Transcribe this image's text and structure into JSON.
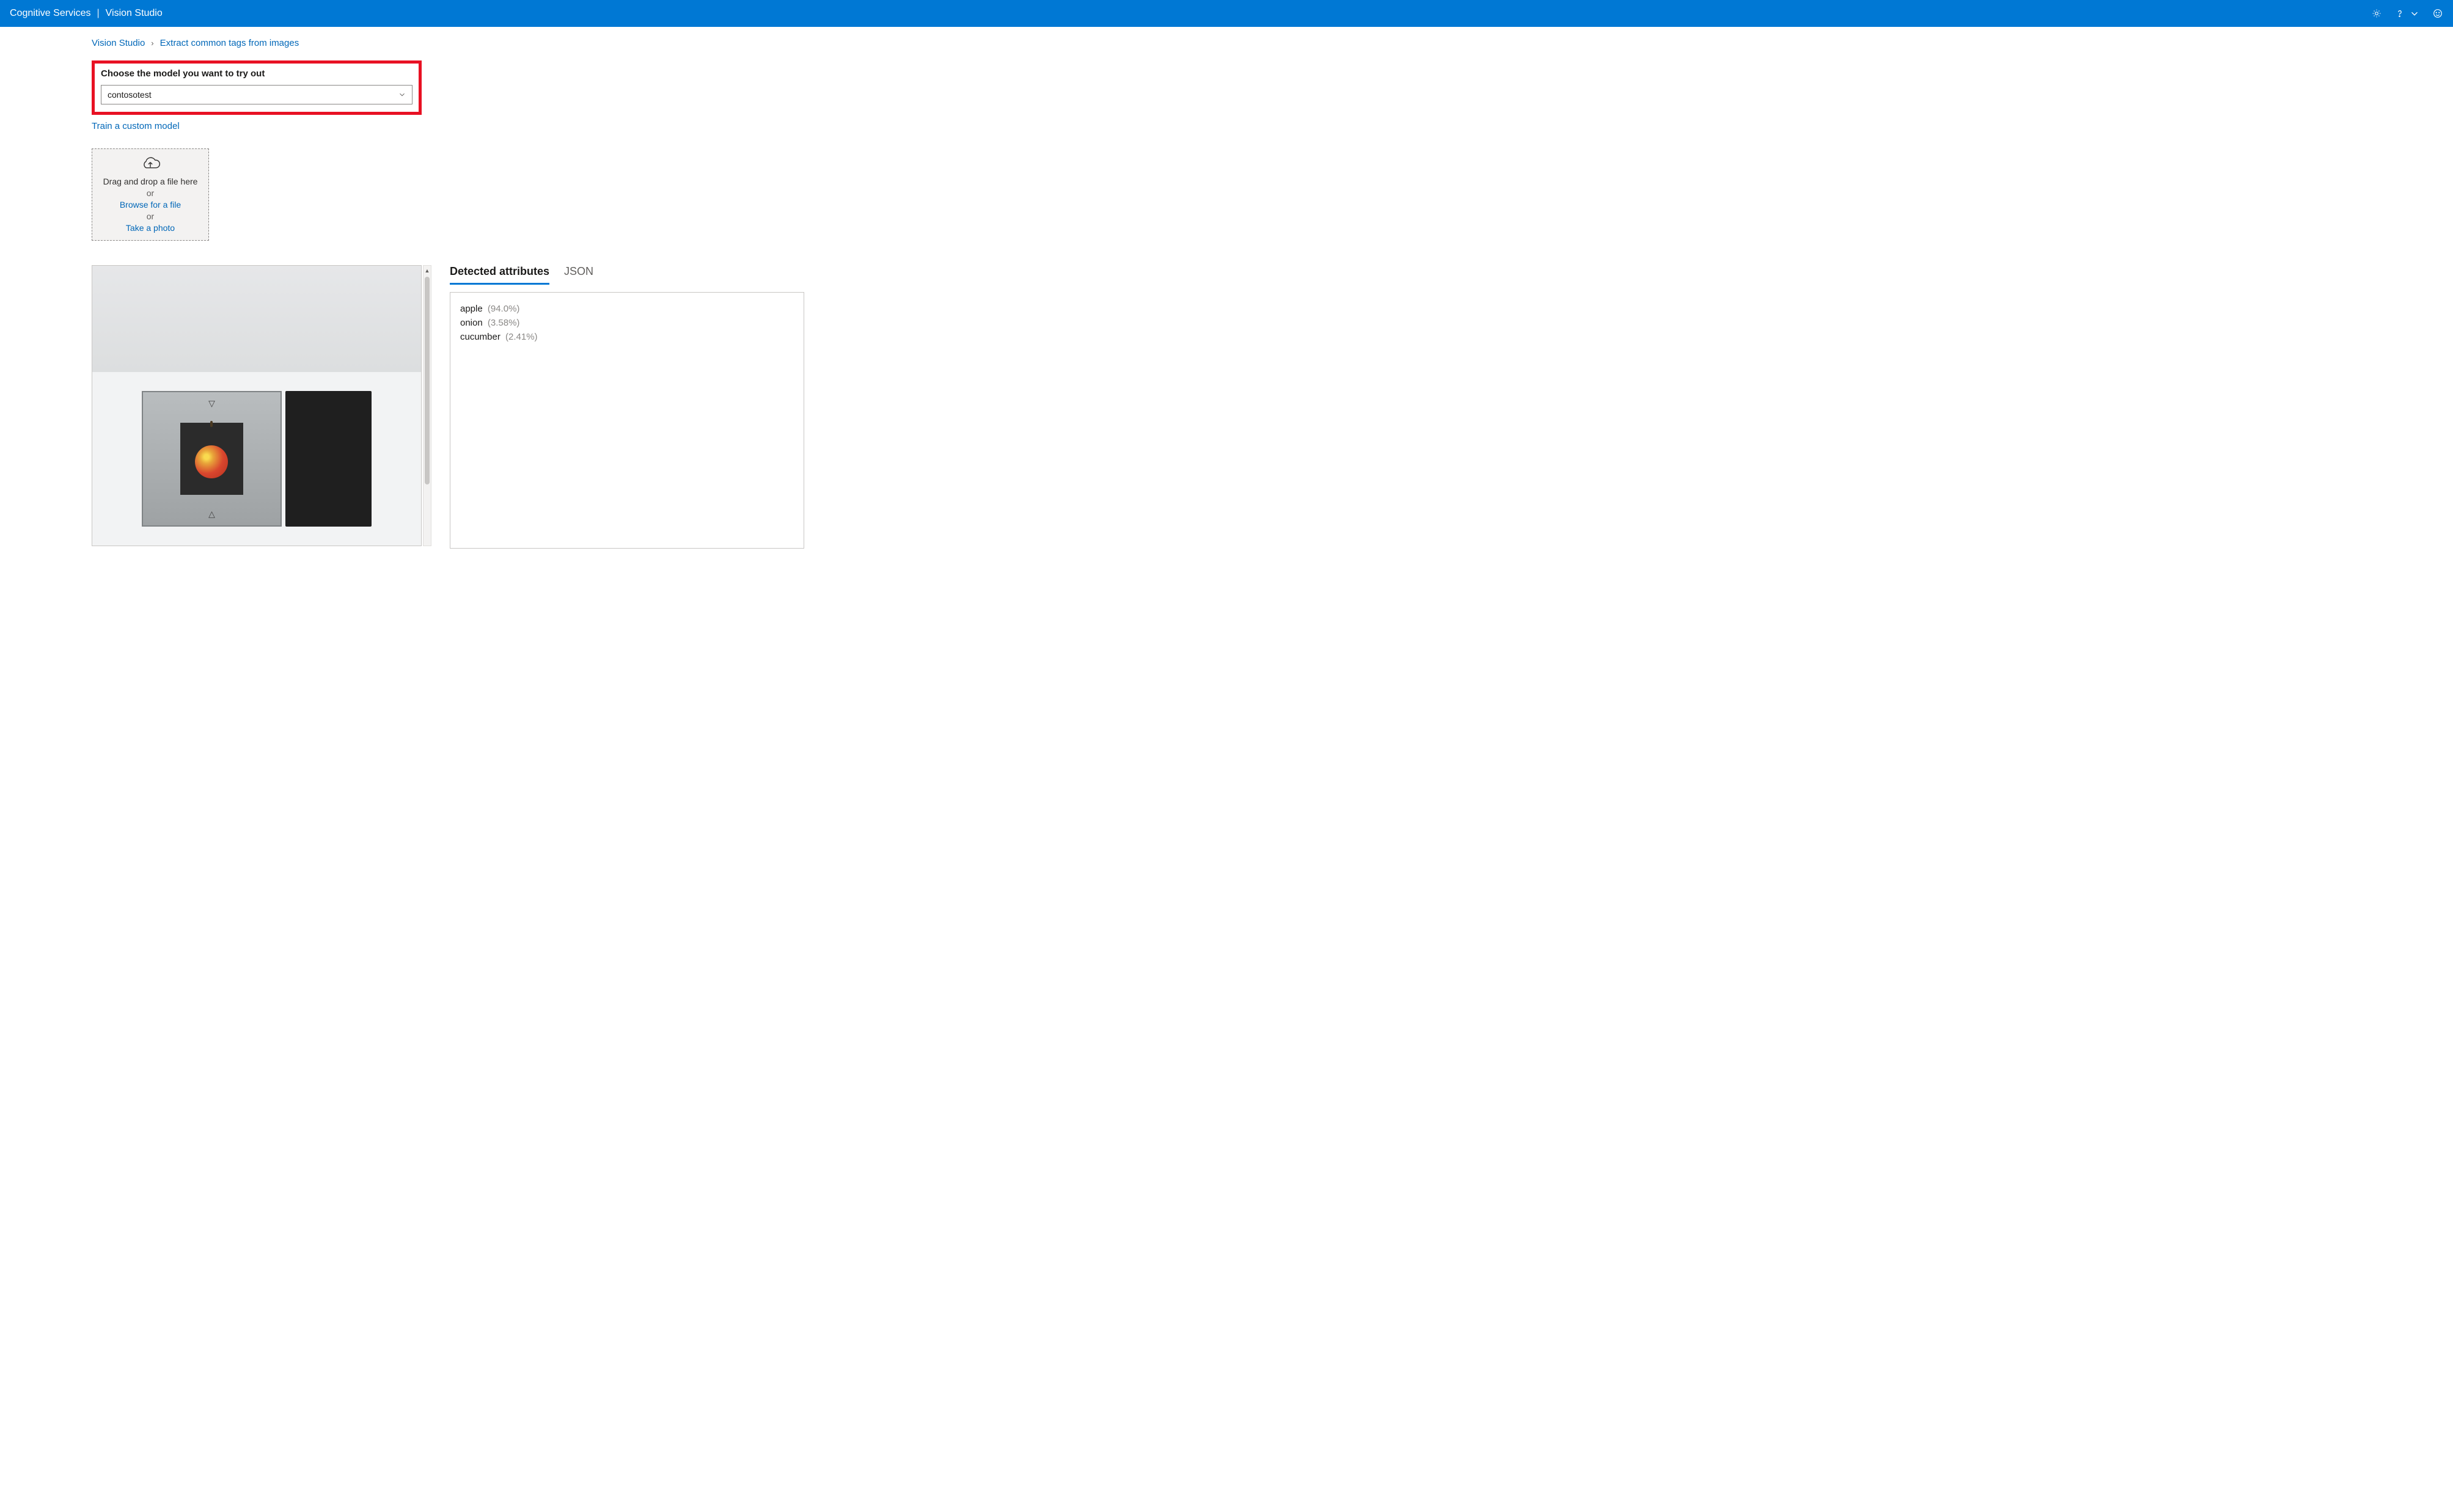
{
  "header": {
    "product": "Cognitive Services",
    "section": "Vision Studio"
  },
  "breadcrumb": {
    "root": "Vision Studio",
    "page": "Extract common tags from images"
  },
  "model_picker": {
    "label": "Choose the model you want to try out",
    "value": "contosotest",
    "train_link": "Train a custom model"
  },
  "dropzone": {
    "line1": "Drag and drop a file here",
    "or": "or",
    "browse": "Browse for a file",
    "take_photo": "Take a photo"
  },
  "tabs": {
    "detected": "Detected attributes",
    "json": "JSON"
  },
  "attributes": [
    {
      "name": "apple",
      "pct": "(94.0%)"
    },
    {
      "name": "onion",
      "pct": "(3.58%)"
    },
    {
      "name": "cucumber",
      "pct": "(2.41%)"
    }
  ]
}
